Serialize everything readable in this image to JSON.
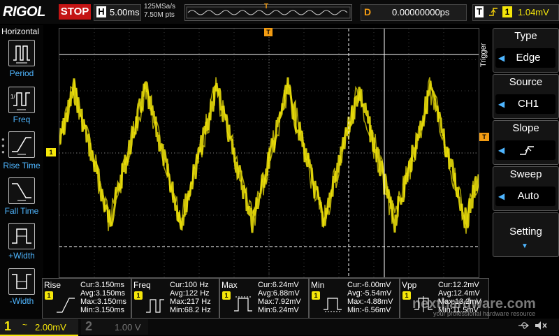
{
  "top": {
    "brand": "RIGOL",
    "run_state": "STOP",
    "timebase_key": "H",
    "timebase": "5.00ms",
    "sample_rate": "125MSa/s",
    "memory_points": "7.50M pts",
    "trigger_marker": "T",
    "delay_key": "D",
    "delay": "0.00000000ps",
    "trig_key": "T",
    "trig_icon": "rising-edge-icon",
    "trig_channel": "1",
    "trig_level": "1.04mV"
  },
  "left_panel": {
    "title": "Horizontal",
    "buttons": [
      {
        "label": "Period",
        "icon": "period-icon"
      },
      {
        "label": "Freq",
        "icon": "freq-icon"
      },
      {
        "label": "Rise Time",
        "icon": "rise-time-icon"
      },
      {
        "label": "Fall Time",
        "icon": "fall-time-icon"
      },
      {
        "label": "+Width",
        "icon": "pos-width-icon"
      },
      {
        "label": "-Width",
        "icon": "neg-width-icon"
      }
    ]
  },
  "right_panel": {
    "section": "Trigger",
    "items": [
      {
        "title": "Type",
        "value": "Edge"
      },
      {
        "title": "Source",
        "value": "CH1"
      },
      {
        "title": "Slope",
        "value": "rising-slope-icon"
      },
      {
        "title": "Sweep",
        "value": "Auto"
      },
      {
        "title": "Setting",
        "value": ""
      }
    ]
  },
  "markers": {
    "ch1": "1",
    "trig_level": "T",
    "trig_pos": "T"
  },
  "measurements": [
    {
      "name": "Rise",
      "ch": "1",
      "cur": "Cur:3.150ms",
      "avg": "Avg:3.150ms",
      "max": "Max:3.150ms",
      "min": "Min:3.150ms"
    },
    {
      "name": "Freq",
      "ch": "1",
      "cur": "Cur:100 Hz",
      "avg": "Avg:122 Hz",
      "max": "Max:217 Hz",
      "min": "Min:68.2 Hz"
    },
    {
      "name": "Max",
      "ch": "1",
      "cur": "Cur:6.24mV",
      "avg": "Avg:6.88mV",
      "max": "Max:7.92mV",
      "min": "Min:6.24mV"
    },
    {
      "name": "Min",
      "ch": "1",
      "cur": "Cur:-6.00mV",
      "avg": "Avg:-5.54mV",
      "max": "Max:-4.88mV",
      "min": "Min:-6.56mV"
    },
    {
      "name": "Vpp",
      "ch": "1",
      "cur": "Cur:12.2mV",
      "avg": "Avg:12.4mV",
      "max": "Max:13.2mV",
      "min": "Min:11.5mV"
    }
  ],
  "bottom": {
    "ch1_num": "1",
    "ch1_coupling": "~",
    "ch1_scale": "2.00mV",
    "ch2_num": "2",
    "ch2_scale": "1.00 V",
    "usb_icon": "usb-icon",
    "speaker_icon": "speaker-muted-icon"
  },
  "watermark": {
    "brand": "nexthardware.com",
    "tagline": "your professional hardware resource"
  },
  "colors": {
    "ch1": "#f5e70a",
    "accent": "#4fb6ff",
    "trigger": "#f39c12",
    "stop": "#c41414"
  }
}
